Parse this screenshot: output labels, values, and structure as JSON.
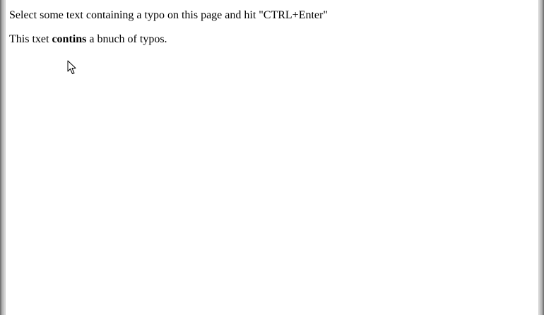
{
  "page": {
    "instruction": "Select some text containing a typo on this page and hit \"CTRL+Enter\"",
    "sentence_part1": "This txet ",
    "sentence_bold": "contins",
    "sentence_part2": " a bnuch of typos."
  },
  "cursor": {
    "icon": "arrow-cursor-icon"
  },
  "colors": {
    "background": "#ffffff",
    "text": "#000000",
    "frame": "#9a9a9a"
  }
}
